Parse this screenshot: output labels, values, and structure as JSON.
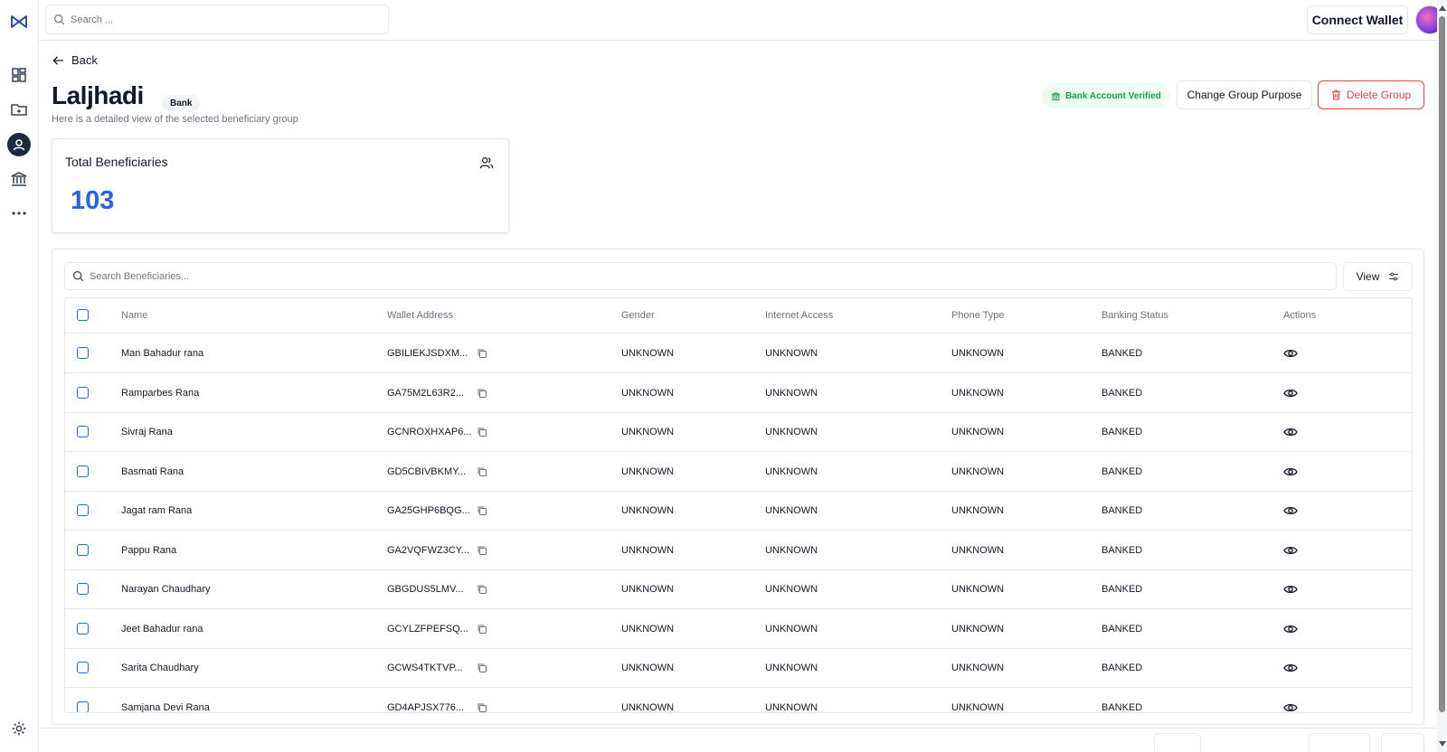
{
  "topbar": {
    "search_placeholder": "Search ...",
    "connect_wallet_label": "Connect Wallet"
  },
  "sidebar": {
    "items": [
      {
        "icon": "logo-icon"
      },
      {
        "icon": "dashboard-icon"
      },
      {
        "icon": "folder-icon"
      },
      {
        "icon": "beneficiary-icon",
        "active": true
      },
      {
        "icon": "bank-icon"
      },
      {
        "icon": "more-icon"
      },
      {
        "icon": "gear-icon"
      }
    ]
  },
  "page": {
    "back_label": "Back",
    "title": "Laljhadi",
    "badge": "Bank",
    "subtitle": "Here is a detailed view of the selected beneficiary group",
    "verified_label": "Bank Account Verified",
    "change_purpose_label": "Change Group Purpose",
    "delete_label": "Delete Group"
  },
  "stats": {
    "label": "Total Beneficiaries",
    "value": "103"
  },
  "table": {
    "search_placeholder": "Search Beneficiaries...",
    "view_label": "View",
    "columns": [
      "Name",
      "Wallet Address",
      "Gender",
      "Internet Access",
      "Phone Type",
      "Banking Status",
      "Actions"
    ],
    "rows": [
      {
        "name": "Man Bahadur rana",
        "wallet": "GBILIEKJSDXM...",
        "gender": "UNKNOWN",
        "internet": "UNKNOWN",
        "phone": "UNKNOWN",
        "banking": "BANKED"
      },
      {
        "name": "Ramparbes Rana",
        "wallet": "GA75M2L63R2...",
        "gender": "UNKNOWN",
        "internet": "UNKNOWN",
        "phone": "UNKNOWN",
        "banking": "BANKED"
      },
      {
        "name": "Sivraj Rana",
        "wallet": "GCNROXHXAP6...",
        "gender": "UNKNOWN",
        "internet": "UNKNOWN",
        "phone": "UNKNOWN",
        "banking": "BANKED"
      },
      {
        "name": "Basmati Rana",
        "wallet": "GD5CBIVBKMY...",
        "gender": "UNKNOWN",
        "internet": "UNKNOWN",
        "phone": "UNKNOWN",
        "banking": "BANKED"
      },
      {
        "name": "Jagat ram Rana",
        "wallet": "GA25GHP6BQG...",
        "gender": "UNKNOWN",
        "internet": "UNKNOWN",
        "phone": "UNKNOWN",
        "banking": "BANKED"
      },
      {
        "name": "Pappu Rana",
        "wallet": "GA2VQFWZ3CY...",
        "gender": "UNKNOWN",
        "internet": "UNKNOWN",
        "phone": "UNKNOWN",
        "banking": "BANKED"
      },
      {
        "name": "Narayan Chaudhary",
        "wallet": "GBGDUS5LMV...",
        "gender": "UNKNOWN",
        "internet": "UNKNOWN",
        "phone": "UNKNOWN",
        "banking": "BANKED"
      },
      {
        "name": "Jeet Bahadur rana",
        "wallet": "GCYLZFPEFSQ...",
        "gender": "UNKNOWN",
        "internet": "UNKNOWN",
        "phone": "UNKNOWN",
        "banking": "BANKED"
      },
      {
        "name": "Sarita Chaudhary",
        "wallet": "GCWS4TKTVP...",
        "gender": "UNKNOWN",
        "internet": "UNKNOWN",
        "phone": "UNKNOWN",
        "banking": "BANKED"
      },
      {
        "name": "Samjana Devi Rana",
        "wallet": "GD4APJSX776...",
        "gender": "UNKNOWN",
        "internet": "UNKNOWN",
        "phone": "UNKNOWN",
        "banking": "BANKED"
      }
    ]
  },
  "colors": {
    "accent": "#2563eb",
    "verified": "#16a34a",
    "danger": "#ef4444"
  }
}
